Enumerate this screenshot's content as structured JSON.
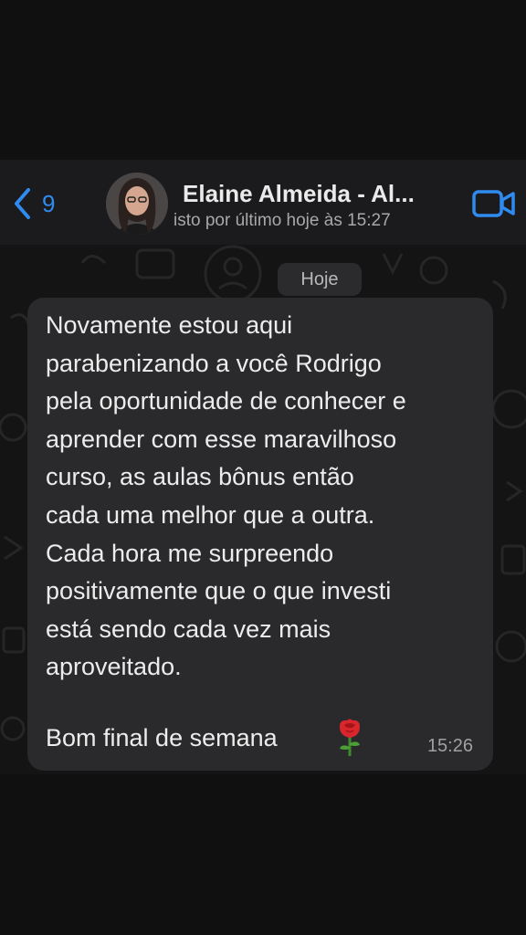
{
  "header": {
    "back_count": "9",
    "contact_name": "Elaine Almeida - Al...",
    "last_seen": "isto por último hoje às 15:27",
    "accent_color": "#2f8bf0"
  },
  "chat": {
    "date_label": "Hoje",
    "message": {
      "lines": [
        "Novamente estou aqui",
        "parabenizando a você Rodrigo",
        "pela oportunidade de conhecer e",
        "aprender com esse maravilhoso",
        "curso, as aulas bônus então",
        "cada uma melhor que a outra.",
        "Cada hora me surpreendo",
        "positivamente que o que investi",
        "está sendo cada vez mais",
        "aproveitado."
      ],
      "closing": "Bom final de semana",
      "emoji_icon": "rose-icon",
      "time": "15:26"
    }
  },
  "icons": {
    "back": "chevron-left-icon",
    "video": "video-camera-icon"
  }
}
